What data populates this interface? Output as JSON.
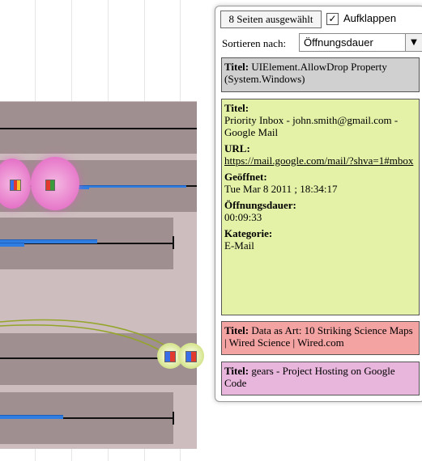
{
  "toolbar": {
    "selected_pages": "8 Seiten ausgewählt",
    "expand_label": "Aufklappen",
    "expand_checked": "✓",
    "sort_label": "Sortieren nach:",
    "sort_value": "Öffnungsdauer",
    "sort_arrow": "▼"
  },
  "cards": [
    {
      "title_key": "Titel:",
      "title": "UIElement.AllowDrop Property (System.Windows)",
      "color": "#d0d0d0"
    },
    {
      "color": "#e4f2a8",
      "title_key": "Titel:",
      "title": "Priority Inbox - john.smith@gmail.com - Google Mail",
      "url_key": "URL:",
      "url": "https://mail.google.com/mail/?shva=1#mbox",
      "opened_key": "Geöffnet:",
      "opened": "Tue Mar 8 2011 ; 18:34:17",
      "duration_key": "Öffnungsdauer:",
      "duration": "00:09:33",
      "category_key": "Kategorie:",
      "category": "E-Mail"
    },
    {
      "title_key": "Titel:",
      "title": "Data as Art: 10 Striking Science Maps | Wired Science | Wired.com",
      "color": "#f4a3a3"
    },
    {
      "title_key": "Titel:",
      "title": "gears - Project Hosting on Google Code",
      "color": "#e8b6dc"
    }
  ]
}
